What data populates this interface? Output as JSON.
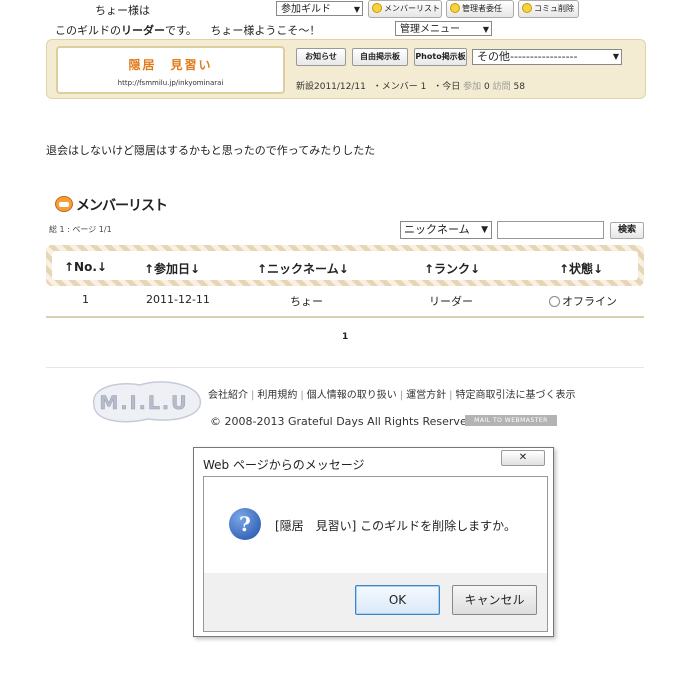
{
  "top": {
    "greeting_user": "ちょー様は",
    "joined_guild_select": "参加ギルド",
    "btn_member_list": "メンバーリスト",
    "btn_admin_transfer": "管理者委任",
    "btn_delete_community": "コミュ削除",
    "role_prefix": "このギルドの",
    "role_name": "リーダー",
    "role_suffix": "です。",
    "welcome": "ちょー様ようこそ～！",
    "admin_menu_select": "管理メニュー"
  },
  "guild": {
    "name": "隠居　見習い",
    "url": "http://fsmmilu.jp/inkyominarai",
    "tab_news": "お知らせ",
    "tab_board": "自由掲示板",
    "tab_photo": "Photo掲示板",
    "other_select": "その他-----------------",
    "stats_created": "新設2011/12/11",
    "stats_members": "・メンバー 1",
    "stats_today": "・今日",
    "stats_join_label": "参加",
    "stats_join_value": "0",
    "stats_visit_label": "訪問",
    "stats_visit_value": "58",
    "message": "退会はしないけど隠居はするかもと思ったので作ってみたりしたた"
  },
  "members": {
    "title": "メンバーリスト",
    "page_info": "総 1 : ページ 1/1",
    "sort_select": "ニックネーム",
    "search_button": "検索",
    "headers": [
      "↑No.↓",
      "↑参加日↓",
      "↑ニックネーム↓",
      "↑ランク↓",
      "↑状態↓"
    ],
    "rows": [
      {
        "no": "1",
        "date": "2011-12-11",
        "nickname": "ちょー",
        "rank": "リーダー",
        "status": "オフライン"
      }
    ],
    "pager": "1"
  },
  "footer": {
    "logo_text": "M.I.L.U",
    "links": [
      "会社紹介",
      "利用規約",
      "個人情報の取り扱い",
      "運営方針",
      "特定商取引法に基づく表示"
    ],
    "copyright": "© 2008-2013 Grateful Days All Rights Reserved.",
    "mail_badge": "MAIL TO WEBMASTER"
  },
  "dialog": {
    "title": "Web ページからのメッセージ",
    "close_glyph": "✕",
    "message": "[隠居　見習い] このギルドを削除しますか。",
    "ok_label": "OK",
    "cancel_label": "キャンセル"
  }
}
